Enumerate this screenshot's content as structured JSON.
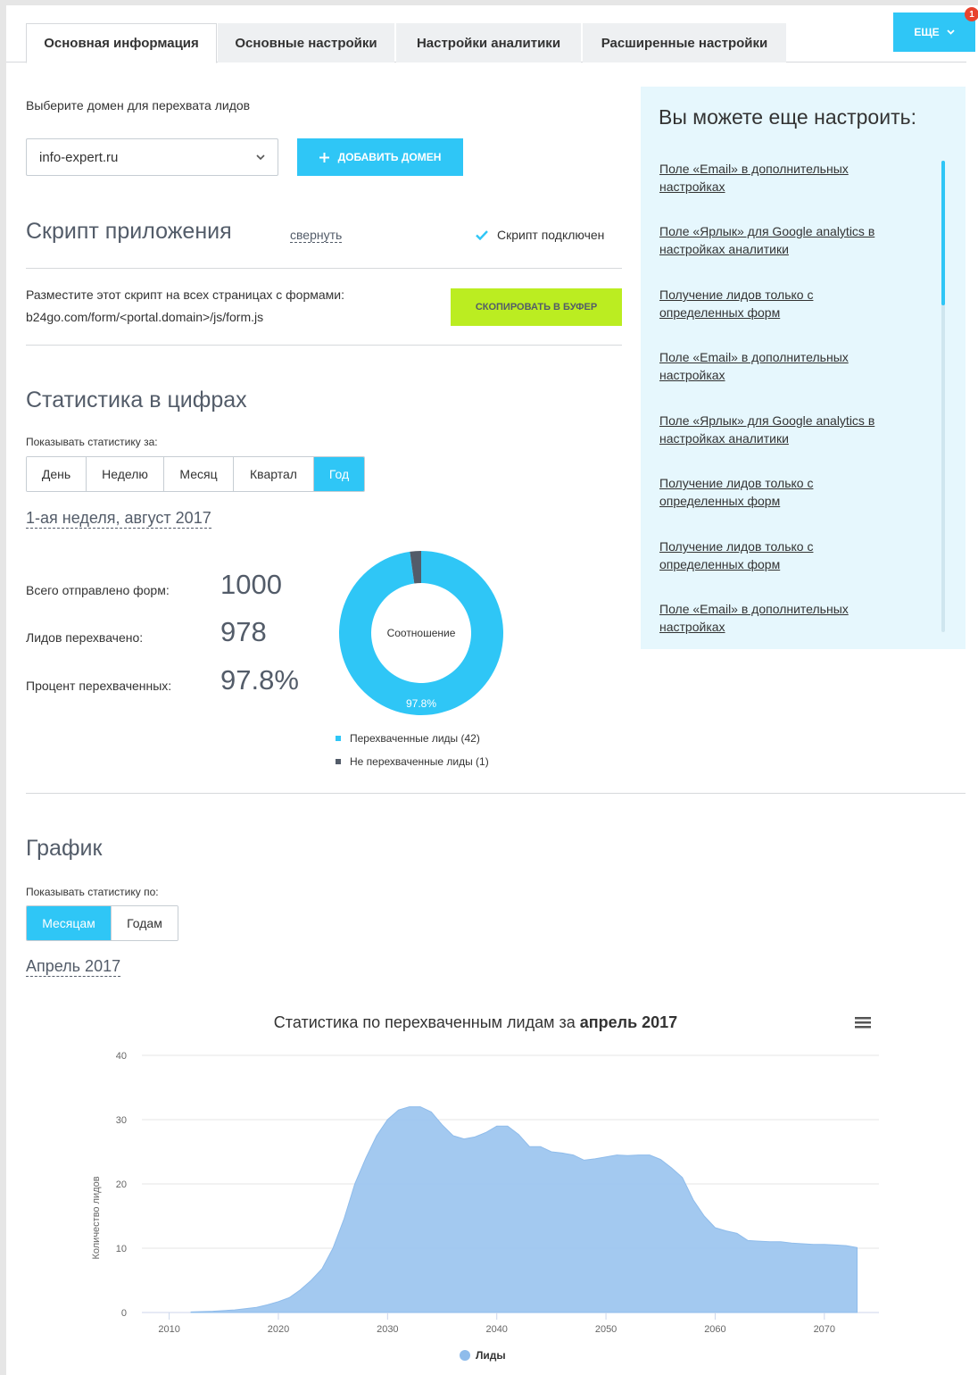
{
  "tabs": [
    {
      "label": "Основная информация",
      "active": true
    },
    {
      "label": "Основные настройки",
      "active": false
    },
    {
      "label": "Настройки аналитики",
      "active": false
    },
    {
      "label": "Расширенные настройки",
      "active": false
    }
  ],
  "more_button": {
    "label": "ЕЩЕ",
    "badge": "1"
  },
  "domain": {
    "label": "Выберите домен для перехвата лидов",
    "selected": "info-expert.ru",
    "add_button": "ДОБАВИТЬ ДОМЕН"
  },
  "script": {
    "title": "Скрипт приложения",
    "collapse_link": "свернуть",
    "status": "Скрипт подключен",
    "instruction": "Разместите этот скрипт на всех страницах с формами:",
    "path": "b24go.com/form/<portal.domain>/js/form.js",
    "copy_button": "СКОПИРОВАТЬ В БУФЕР"
  },
  "stats": {
    "title": "Статистика в цифрах",
    "period_label": "Показывать статистику за:",
    "periods": [
      "День",
      "Неделю",
      "Месяц",
      "Квартал",
      "Год"
    ],
    "active_period": "Год",
    "current_period": "1-ая неделя, август 2017",
    "rows": [
      {
        "label": "Всего отправлено форм:",
        "value": "1000"
      },
      {
        "label": "Лидов перехвачено:",
        "value": "978"
      },
      {
        "label": "Процент перехваченных:",
        "value": "97.8%"
      }
    ],
    "donut": {
      "center_label": "Соотношение",
      "percent_label": "97.8%",
      "captured_fraction": 0.978,
      "colors": {
        "captured": "#2fc6f6",
        "missed": "#535c69"
      }
    },
    "legend": [
      {
        "label": "Перехваченные лиды (42)",
        "color": "#2fc6f6"
      },
      {
        "label": "Не перехваченные лиды (1)",
        "color": "#535c69"
      }
    ]
  },
  "graph": {
    "title": "График",
    "by_label": "Показывать статистику по:",
    "modes": [
      "Месяцам",
      "Годам"
    ],
    "active_mode": "Месяцам",
    "current_period": "Апрель 2017"
  },
  "side_panel": {
    "title": "Вы можете еще настроить:",
    "items": [
      "Поле «Email» в дополнительных настройках",
      "Поле «Ярлык» для Google analytics в настройках аналитики",
      "Получение лидов только с определенных форм",
      "Поле «Email» в дополнительных настройках",
      "Поле «Ярлык» для Google analytics в настройках аналитики",
      "Получение лидов только с определенных форм",
      "Получение лидов только с определенных форм",
      "Поле «Email» в дополнительных настройках"
    ]
  },
  "chart_data": {
    "type": "area",
    "title_prefix": "Статистика по перехваченным лидам за ",
    "title_bold": "апрель 2017",
    "ylabel": "Количество лидов",
    "xlabel": "",
    "ylim": [
      0,
      40
    ],
    "yticks": [
      0,
      10,
      20,
      30,
      40
    ],
    "xticks": [
      2010,
      2020,
      2030,
      2040,
      2050,
      2060,
      2070
    ],
    "xlim": [
      2007.5,
      2075
    ],
    "grid": true,
    "legend_position": "bottom-center",
    "color": "#9ec6ef",
    "series": [
      {
        "name": "Лиды",
        "x": [
          2012,
          2014,
          2016,
          2018,
          2019,
          2020,
          2021,
          2022,
          2023,
          2024,
          2025,
          2026,
          2027,
          2028,
          2029,
          2030,
          2031,
          2032,
          2033,
          2034,
          2035,
          2036,
          2037,
          2038,
          2039,
          2040,
          2041,
          2042,
          2043,
          2044,
          2045,
          2046,
          2047,
          2048,
          2049,
          2050,
          2051,
          2052,
          2053,
          2054,
          2055,
          2056,
          2057,
          2058,
          2059,
          2060,
          2061,
          2062,
          2063,
          2064,
          2065,
          2066,
          2067,
          2068,
          2069,
          2070,
          2071,
          2072,
          2073
        ],
        "y": [
          0.1,
          0.2,
          0.4,
          0.8,
          1.2,
          1.7,
          2.3,
          3.5,
          5,
          6.8,
          10,
          14.5,
          20,
          24,
          27.5,
          30,
          31.5,
          32,
          32,
          31.2,
          29.2,
          27.5,
          27,
          27.3,
          28,
          29,
          29,
          27.7,
          25.8,
          25.8,
          25,
          24.8,
          24.5,
          23.7,
          23.9,
          24.2,
          24.5,
          24.4,
          24.5,
          24.5,
          23.8,
          22.5,
          21,
          17.5,
          15,
          13.2,
          12.7,
          12.3,
          11.2,
          11.1,
          11,
          11,
          10.8,
          10.7,
          10.6,
          10.6,
          10.5,
          10.4,
          10.1
        ]
      }
    ]
  }
}
